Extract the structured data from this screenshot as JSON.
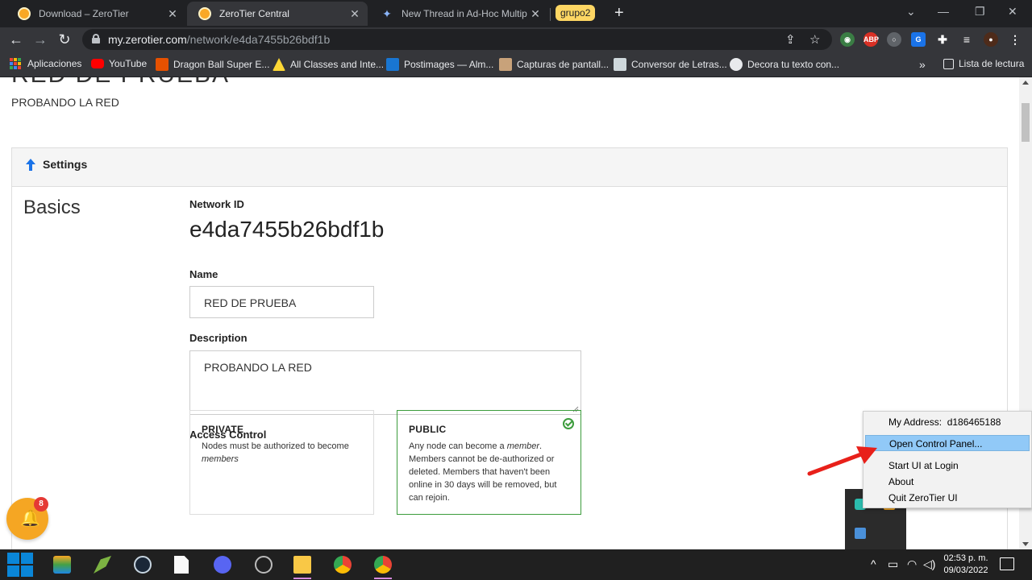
{
  "browser": {
    "tabs": [
      {
        "title": "Download – ZeroTier",
        "active": false,
        "icon": "zerotier-favicon"
      },
      {
        "title": "ZeroTier Central",
        "active": true,
        "icon": "zerotier-favicon"
      },
      {
        "title": "New Thread in Ad-Hoc Multiplay",
        "active": false,
        "icon": "adhoc-favicon"
      }
    ],
    "tab_group_label": "grupo2",
    "url_host": "my.zerotier.com",
    "url_path": "/network/e4da7455b26bdf1b",
    "bookmarks": [
      {
        "label": "Aplicaciones",
        "icon": "apps-grid-icon"
      },
      {
        "label": "YouTube",
        "icon": "youtube-icon"
      },
      {
        "label": "Dragon Ball Super E...",
        "icon": "dragonball-icon"
      },
      {
        "label": "All Classes and Inte...",
        "icon": "allclasses-icon"
      },
      {
        "label": "Postimages — Alm...",
        "icon": "postimages-icon"
      },
      {
        "label": "Capturas de pantall...",
        "icon": "capturas-icon"
      },
      {
        "label": "Conversor de Letras...",
        "icon": "conversor-icon"
      },
      {
        "label": "Decora tu texto con...",
        "icon": "decora-icon"
      }
    ],
    "reading_list_label": "Lista de lectura",
    "extensions": {
      "abp_label": "ABP"
    }
  },
  "page": {
    "heading": "RED DE PRUEBA",
    "description": "PROBANDO LA RED",
    "settings_title": "Settings",
    "basics_title": "Basics",
    "network_id_label": "Network ID",
    "network_id": "e4da7455b26bdf1b",
    "name_label": "Name",
    "name_value": "RED DE PRUEBA",
    "description_label": "Description",
    "description_value": "PROBANDO LA RED",
    "access_control_label": "Access Control",
    "private_card": {
      "title": "PRIVATE",
      "desc_before": "Nodes must be authorized to become ",
      "desc_em": "members"
    },
    "public_card": {
      "title": "PUBLIC",
      "desc_before": "Any node can become a ",
      "desc_em": "member",
      "desc_after": ". Members cannot be de-authorized or deleted. Members that haven't been online in 30 days will be removed, but can rejoin.",
      "selected": true
    },
    "notification_count": "8"
  },
  "context_menu": {
    "my_address_label": "My Address:",
    "my_address_value": "d186465188",
    "items": [
      {
        "label": "Open Control Panel...",
        "highlighted": true
      },
      {
        "label": "Start UI at Login"
      },
      {
        "label": "About"
      },
      {
        "label": "Quit ZeroTier UI"
      }
    ]
  },
  "taskbar": {
    "time": "02:53 p. m.",
    "date": "09/03/2022"
  },
  "colors": {
    "accent_blue": "#1a73e8",
    "zerotier_orange": "#f9a825",
    "selected_green": "#3c9c3c",
    "bell_orange": "#f5a623",
    "arrow_red": "#e8201a",
    "menu_highlight": "#91c9f7"
  }
}
